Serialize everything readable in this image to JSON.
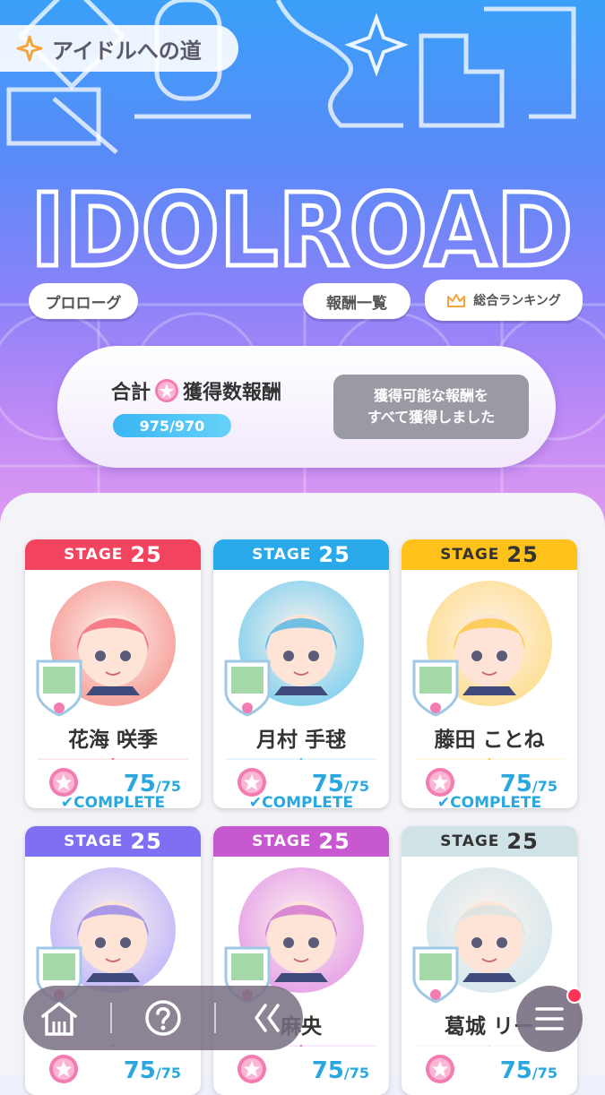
{
  "header": {
    "title": "アイドルへの道",
    "logo_text": "IDOLROAD",
    "prologue_button": "プロローグ",
    "rewards_list_button": "報酬一覧",
    "ranking_button": "総合ランキング"
  },
  "reward_summary": {
    "label_prefix": "合計",
    "label_suffix": "獲得数報酬",
    "count": "975/970",
    "status": "獲得可能な報酬を\nすべて獲得しました"
  },
  "stage_label": "STAGE",
  "cards": [
    {
      "stage": "25",
      "name": "花海 咲季",
      "score": "75",
      "total": "/75",
      "status": "COMPLETE",
      "color": "#f2445e",
      "avatar_color": "#f6a7a0"
    },
    {
      "stage": "25",
      "name": "月村 手毬",
      "score": "75",
      "total": "/75",
      "status": "COMPLETE",
      "color": "#29a9ea",
      "avatar_color": "#8fd4ee"
    },
    {
      "stage": "25",
      "name": "藤田 ことね",
      "score": "75",
      "total": "/75",
      "status": "COMPLETE",
      "color": "#ffc21a",
      "avatar_color": "#fde09a"
    },
    {
      "stage": "25",
      "name": "",
      "score": "75",
      "total": "/75",
      "status": "",
      "color": "#7f6ff3",
      "avatar_color": "#c7bdf8"
    },
    {
      "stage": "25",
      "name": "麻央",
      "score": "75",
      "total": "/75",
      "status": "",
      "color": "#c758cf",
      "avatar_color": "#e7a9e8"
    },
    {
      "stage": "25",
      "name": "葛城 リー",
      "score": "75",
      "total": "/75",
      "status": "",
      "color": "#cfe3e6",
      "avatar_color": "#d9e9ee"
    }
  ],
  "nav": {
    "home_icon": "home-icon",
    "help_icon": "help-icon",
    "back_icon": "back-icon",
    "menu_icon": "menu-icon"
  }
}
